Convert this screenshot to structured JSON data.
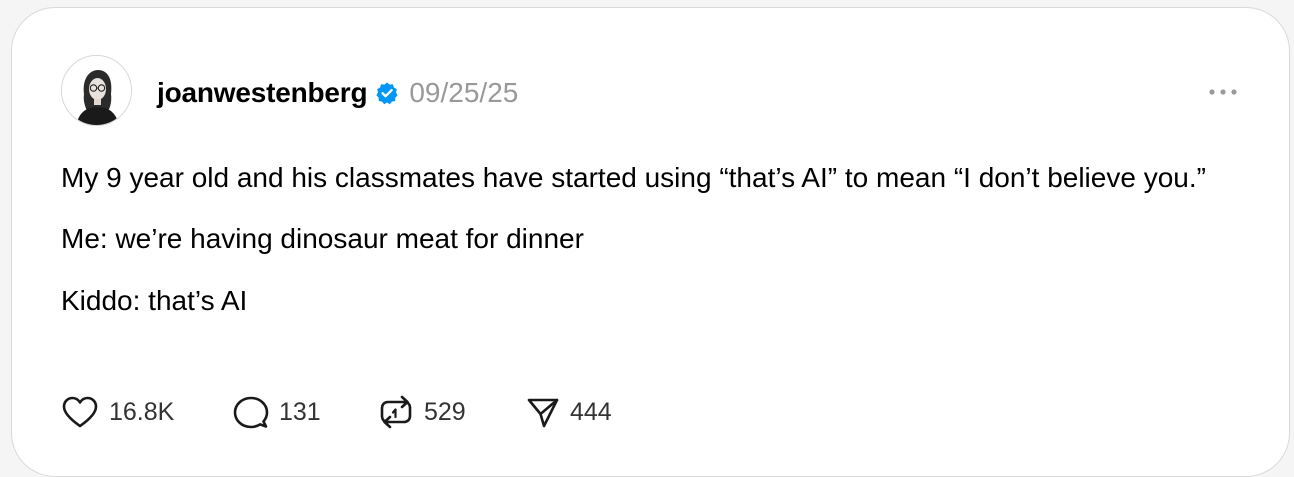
{
  "post": {
    "username": "joanwestenberg",
    "date": "09/25/25",
    "paragraphs": [
      "My 9 year old and his classmates have started using “that’s AI” to mean “I don’t believe you.”",
      "Me: we’re having dinosaur meat for dinner",
      "Kiddo: that’s AI"
    ],
    "actions": {
      "likes": "16.8K",
      "replies": "131",
      "reposts": "529",
      "shares": "444"
    }
  },
  "icons": {
    "verified": "verified-badge-icon",
    "more": "more-options-icon",
    "like": "heart-icon",
    "reply": "speech-bubble-icon",
    "repost": "repost-arrows-icon",
    "share": "paper-plane-icon"
  },
  "colors": {
    "verified": "#0095f6",
    "date": "#999999",
    "count": "#333333"
  }
}
